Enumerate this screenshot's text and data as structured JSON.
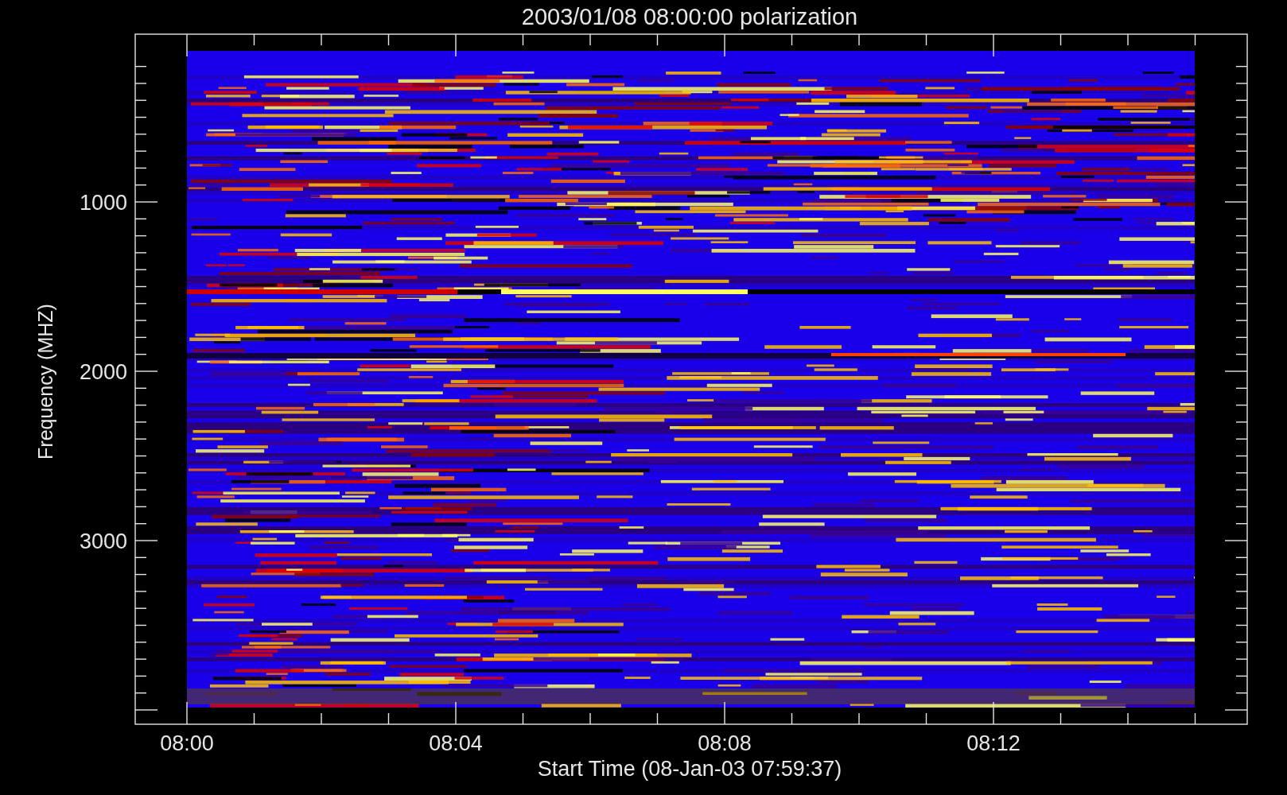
{
  "title": "2003/01/08 08:00:00 polarization",
  "y_axis": {
    "title": "Frequency (MHZ)",
    "tick_labels": [
      "1000",
      "2000",
      "3000"
    ]
  },
  "x_axis": {
    "title": "Start Time (08-Jan-03 07:59:37)",
    "tick_labels": [
      "08:00",
      "08:04",
      "08:08",
      "08:12"
    ]
  }
}
